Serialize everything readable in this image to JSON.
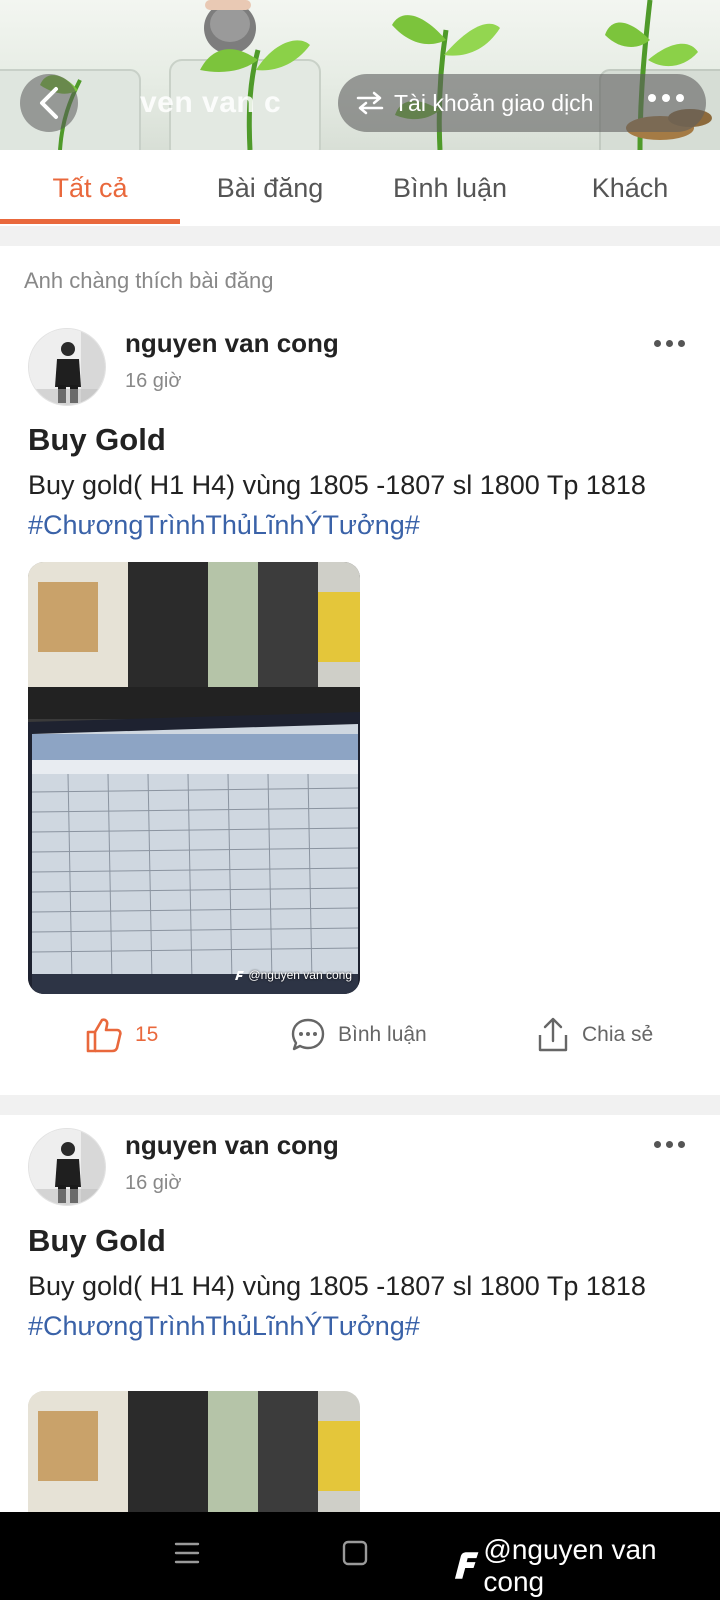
{
  "header": {
    "back_label": "Back",
    "banner_name": "ven van c",
    "account_button_label": "Tài khoản giao dịch"
  },
  "tabs": [
    {
      "label": "Tất cả",
      "active": true
    },
    {
      "label": "Bài đăng",
      "active": false
    },
    {
      "label": "Bình luận",
      "active": false
    },
    {
      "label": "Khách",
      "active": false
    }
  ],
  "section_label": "Anh chàng thích bài đăng",
  "posts": [
    {
      "author": "nguyen van cong",
      "time": "16 giờ",
      "title": "Buy Gold",
      "body": "Buy gold( H1 H4) vùng 1805 -1807 sl 1800 Tp 1818",
      "hashtag": "#ChươngTrìnhThủLĩnhÝTưởng#",
      "image_watermark": "@nguyen van cong",
      "likes": "15",
      "comment_label": "Bình luận",
      "share_label": "Chia sẻ"
    },
    {
      "author": "nguyen van cong",
      "time": "16 giờ",
      "title": "Buy Gold",
      "body": "Buy gold( H1 H4) vùng 1805 -1807 sl 1800 Tp 1818",
      "hashtag": "#ChươngTrìnhThủLĩnhÝTưởng#"
    }
  ],
  "footer_watermark": "@nguyen van cong",
  "colors": {
    "accent": "#e9683c",
    "hashtag": "#3a62a8",
    "nav_bar": "#000000"
  },
  "icons": {
    "back": "chevron-left-icon",
    "account": "swap-arrows-icon",
    "more": "more-dots-icon",
    "like": "thumbs-up-icon",
    "comment": "comment-bubble-icon",
    "share": "share-icon",
    "nav_menu": "menu-lines-icon",
    "nav_home": "square-home-icon",
    "watermark_logo": "brand-logo-icon"
  }
}
